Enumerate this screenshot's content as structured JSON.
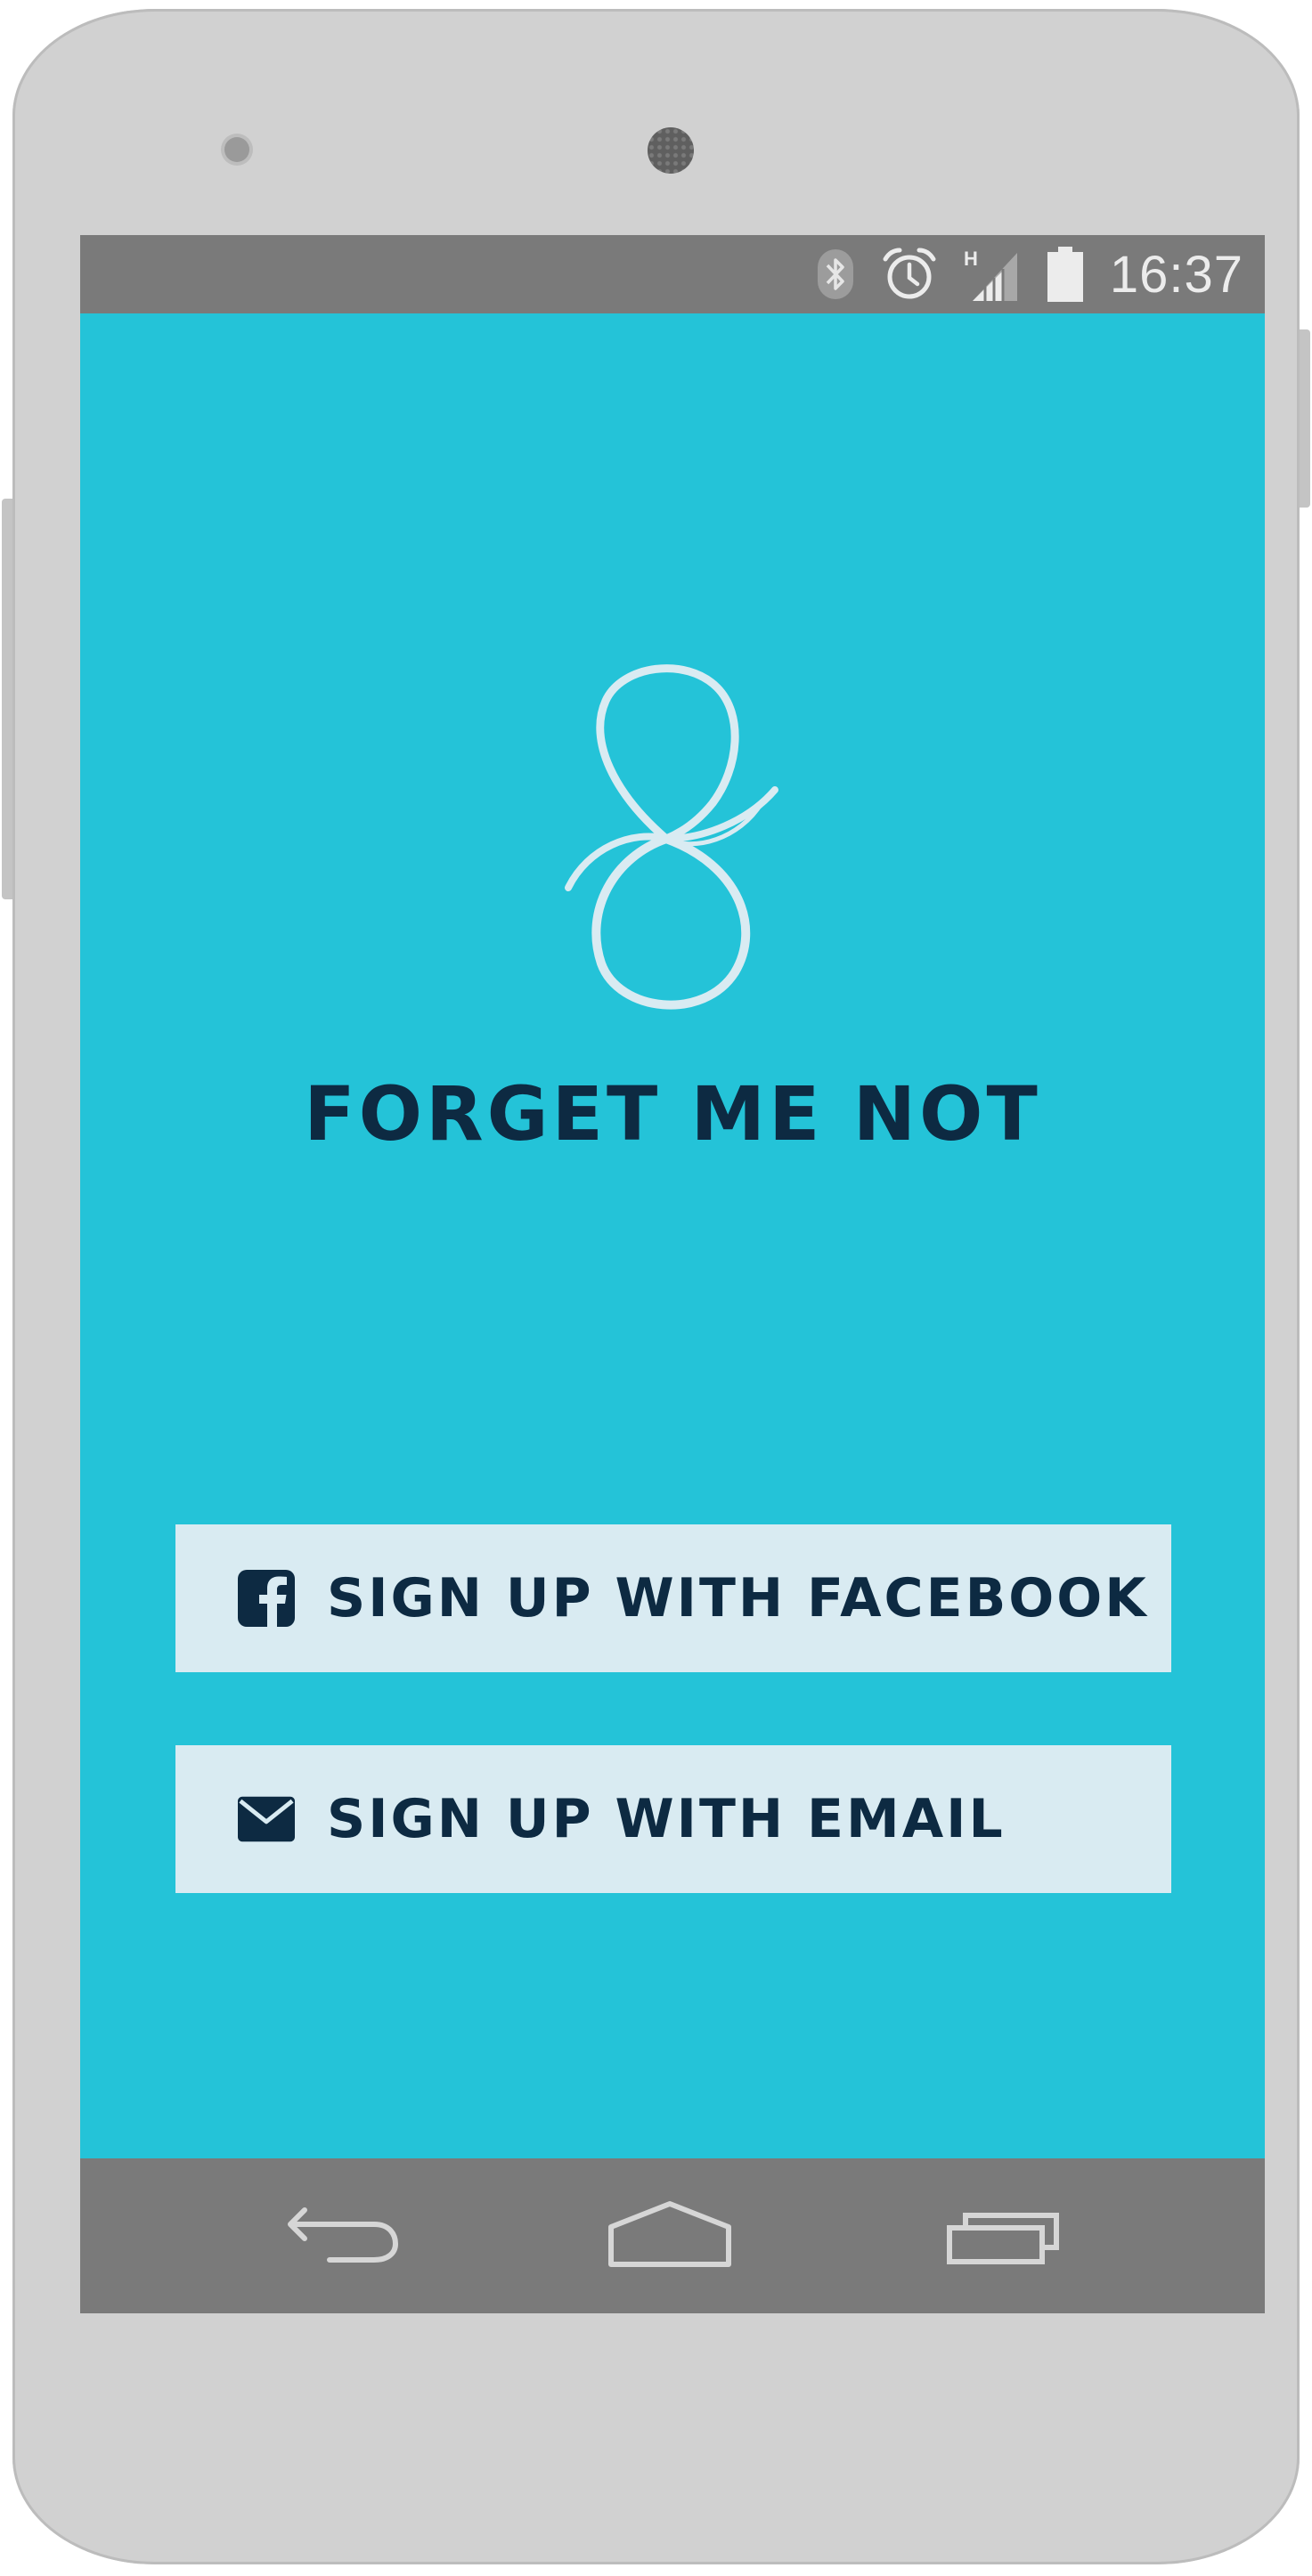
{
  "status_bar": {
    "time": "16:37",
    "icons": [
      "bluetooth-icon",
      "alarm-icon",
      "signal-h-icon",
      "battery-icon"
    ]
  },
  "app": {
    "title": "FORGET ME NOT",
    "logo_icon": "figure-eight-ribbon-icon"
  },
  "buttons": {
    "facebook": {
      "label": "SIGN UP WITH FACEBOOK",
      "icon": "facebook-icon"
    },
    "email": {
      "label": "SIGN UP WITH EMAIL",
      "icon": "envelope-icon"
    }
  },
  "nav_bar": {
    "icons": [
      "back-icon",
      "home-icon",
      "recents-icon"
    ]
  },
  "colors": {
    "background": "#24c3d8",
    "button_background": "#d9ebf2",
    "text": "#0d2a42",
    "system_bars": "#7a7a7a",
    "phone_body": "#d1d1d1"
  }
}
